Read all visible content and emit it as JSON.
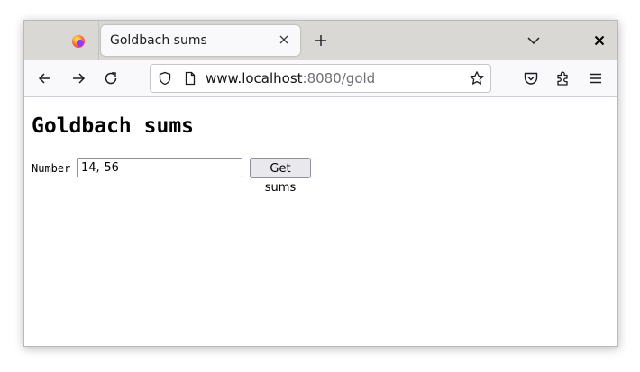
{
  "browser": {
    "tab": {
      "title": "Goldbach sums"
    },
    "url": {
      "host": "www.localhost",
      "path": ":8080/gold"
    },
    "icons": {
      "logo": "firefox-logo-icon",
      "tab_close": "close-icon",
      "new_tab": "plus-icon",
      "tab_list": "chevron-down-icon",
      "window_close": "close-icon",
      "back": "arrow-left-icon",
      "forward": "arrow-right-icon",
      "reload": "reload-icon",
      "site_info": "shield-icon",
      "page": "page-icon",
      "bookmark": "star-icon",
      "pocket": "pocket-icon",
      "extensions": "puzzle-icon",
      "menu": "hamburger-icon"
    }
  },
  "page": {
    "title": "Goldbach sums",
    "form": {
      "label": "Number",
      "input_value": "14,-56",
      "button_label": "Get sums"
    }
  },
  "colors": {
    "tabbar_bg": "#dad8d5",
    "toolbar_bg": "#f9f9fb",
    "url_path_gray": "#6f6f76"
  }
}
